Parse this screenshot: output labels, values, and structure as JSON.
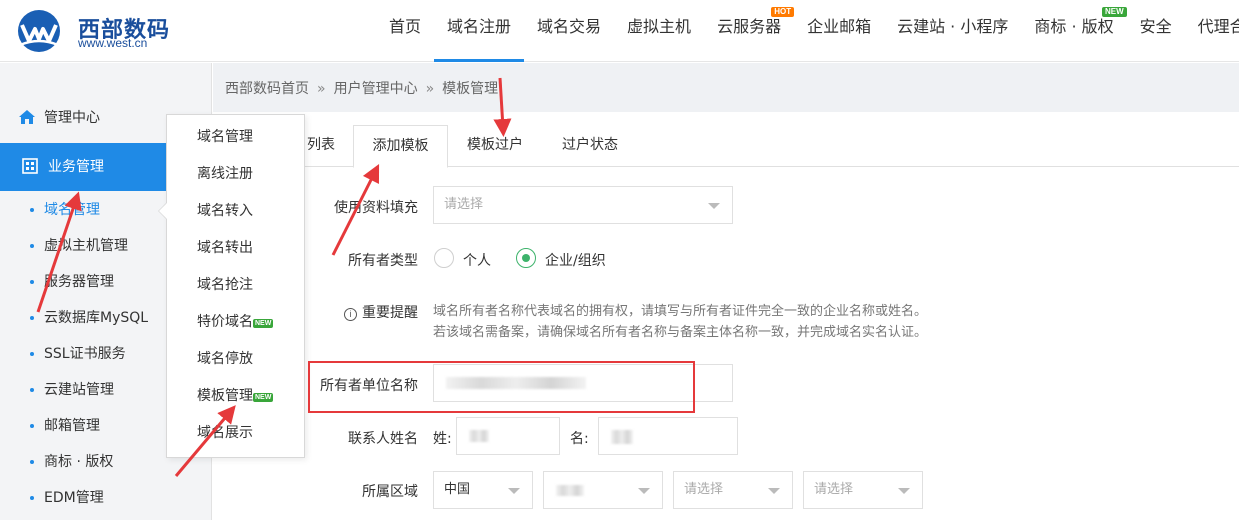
{
  "header": {
    "logo_title": "西部数码",
    "logo_url": "www.west.cn",
    "nav": [
      {
        "label": "首页"
      },
      {
        "label": "域名注册",
        "active": true
      },
      {
        "label": "域名交易"
      },
      {
        "label": "虚拟主机"
      },
      {
        "label": "云服务器",
        "badge": "HOT"
      },
      {
        "label": "企业邮箱"
      },
      {
        "label": "云建站 · 小程序"
      },
      {
        "label": "商标 · 版权",
        "badge": "NEW"
      },
      {
        "label": "安全"
      },
      {
        "label": "代理合"
      }
    ]
  },
  "sidebar": {
    "home": "管理中心",
    "section": "业务管理",
    "items": [
      {
        "label": "域名管理",
        "selected": true
      },
      {
        "label": "虚拟主机管理"
      },
      {
        "label": "服务器管理"
      },
      {
        "label": "云数据库MySQL"
      },
      {
        "label": "SSL证书服务"
      },
      {
        "label": "云建站管理"
      },
      {
        "label": "邮箱管理"
      },
      {
        "label": "商标 · 版权"
      },
      {
        "label": "EDM管理"
      }
    ]
  },
  "flyout": {
    "items": [
      {
        "label": "域名管理"
      },
      {
        "label": "离线注册"
      },
      {
        "label": "域名转入"
      },
      {
        "label": "域名转出"
      },
      {
        "label": "域名抢注"
      },
      {
        "label": "特价域名",
        "badge": "NEW"
      },
      {
        "label": "域名停放"
      },
      {
        "label": "模板管理",
        "badge": "NEW"
      },
      {
        "label": "域名展示"
      }
    ]
  },
  "breadcrumb": {
    "items": [
      "西部数码首页",
      "用户管理中心",
      "模板管理"
    ],
    "separator": "»"
  },
  "tabs": [
    {
      "label": "列表"
    },
    {
      "label": "添加模板",
      "active": true
    },
    {
      "label": "模板过户"
    },
    {
      "label": "过户状态"
    }
  ],
  "form": {
    "fill_label": "使用资料填充",
    "fill_placeholder": "请选择",
    "owner_type_label": "所有者类型",
    "owner_type_options": [
      {
        "label": "个人",
        "checked": false
      },
      {
        "label": "企业/组织",
        "checked": true
      }
    ],
    "notice_label": "重要提醒",
    "notice_icon": "i",
    "notice_lines": [
      "域名所有者名称代表域名的拥有权，请填写与所有者证件完全一致的企业名称或姓名。",
      "若该域名需备案，请确保域名所有者名称与备案主体名称一致，并完成域名实名认证。"
    ],
    "org_name_label": "所有者单位名称",
    "contact_label": "联系人姓名",
    "surname_label": "姓:",
    "given_label": "名:",
    "region_label": "所属区域",
    "region_country": "中国",
    "region_placeholder_1": "请选择",
    "region_placeholder_2": "请选择"
  },
  "colors": {
    "accent": "#1f8ae6",
    "annotation_red": "#e5393b",
    "radio_green": "#3db36b"
  }
}
